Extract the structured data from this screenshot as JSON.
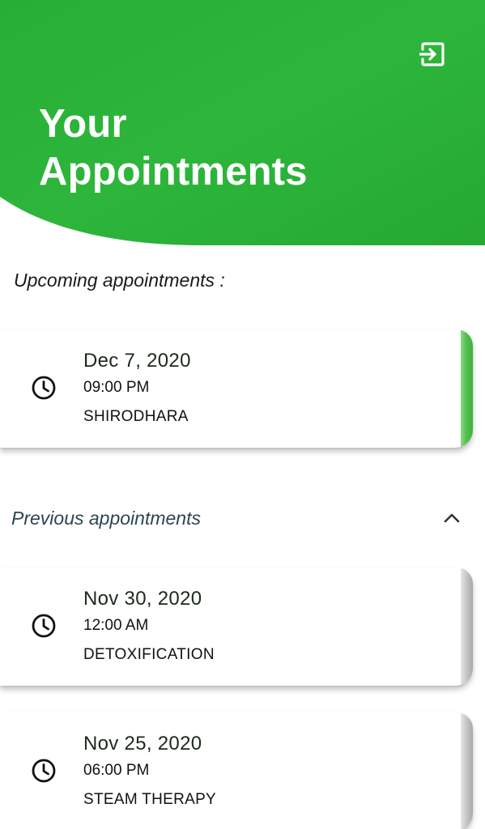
{
  "header": {
    "title": "Your Appointments",
    "logout_icon": "logout-icon",
    "color": "#2bb33a"
  },
  "upcoming": {
    "label": "Upcoming appointments :",
    "items": [
      {
        "date": "Dec 7, 2020",
        "time": "09:00 PM",
        "service": "SHIRODHARA",
        "icon": "clock-icon"
      }
    ]
  },
  "previous": {
    "label": "Previous appointments",
    "toggle_icon": "chevron-up-icon",
    "items": [
      {
        "date": "Nov 30, 2020",
        "time": "12:00 AM",
        "service": "DETOXIFICATION",
        "icon": "clock-icon"
      },
      {
        "date": "Nov 25, 2020",
        "time": "06:00 PM",
        "service": "STEAM THERAPY",
        "icon": "clock-icon"
      }
    ]
  },
  "colors": {
    "accent_green": "#2bb33a",
    "upcoming_edge": "#4fbe4b",
    "previous_edge": "#b9b9b9",
    "previous_label": "#2b4650"
  }
}
